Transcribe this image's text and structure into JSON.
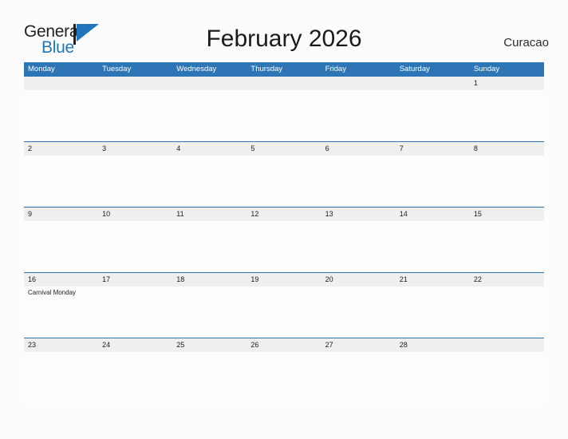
{
  "logo": {
    "word_one": "General",
    "word_two": "Blue",
    "flag_icon": "flag-triangle-icon",
    "flag_color": "#1f76bc",
    "pole_color": "#231f20"
  },
  "header": {
    "title": "February 2026",
    "country": "Curacao"
  },
  "calendar": {
    "accent_color": "#2e75b6",
    "date_band_color": "#efefef",
    "weekdays": [
      "Monday",
      "Tuesday",
      "Wednesday",
      "Thursday",
      "Friday",
      "Saturday",
      "Sunday"
    ],
    "weeks": [
      {
        "days": [
          {
            "date": "",
            "events": []
          },
          {
            "date": "",
            "events": []
          },
          {
            "date": "",
            "events": []
          },
          {
            "date": "",
            "events": []
          },
          {
            "date": "",
            "events": []
          },
          {
            "date": "",
            "events": []
          },
          {
            "date": "1",
            "events": []
          }
        ]
      },
      {
        "days": [
          {
            "date": "2",
            "events": []
          },
          {
            "date": "3",
            "events": []
          },
          {
            "date": "4",
            "events": []
          },
          {
            "date": "5",
            "events": []
          },
          {
            "date": "6",
            "events": []
          },
          {
            "date": "7",
            "events": []
          },
          {
            "date": "8",
            "events": []
          }
        ]
      },
      {
        "days": [
          {
            "date": "9",
            "events": []
          },
          {
            "date": "10",
            "events": []
          },
          {
            "date": "11",
            "events": []
          },
          {
            "date": "12",
            "events": []
          },
          {
            "date": "13",
            "events": []
          },
          {
            "date": "14",
            "events": []
          },
          {
            "date": "15",
            "events": []
          }
        ]
      },
      {
        "days": [
          {
            "date": "16",
            "events": [
              "Carnival Monday"
            ]
          },
          {
            "date": "17",
            "events": []
          },
          {
            "date": "18",
            "events": []
          },
          {
            "date": "19",
            "events": []
          },
          {
            "date": "20",
            "events": []
          },
          {
            "date": "21",
            "events": []
          },
          {
            "date": "22",
            "events": []
          }
        ]
      },
      {
        "days": [
          {
            "date": "23",
            "events": []
          },
          {
            "date": "24",
            "events": []
          },
          {
            "date": "25",
            "events": []
          },
          {
            "date": "26",
            "events": []
          },
          {
            "date": "27",
            "events": []
          },
          {
            "date": "28",
            "events": []
          },
          {
            "date": "",
            "events": []
          }
        ]
      }
    ]
  }
}
